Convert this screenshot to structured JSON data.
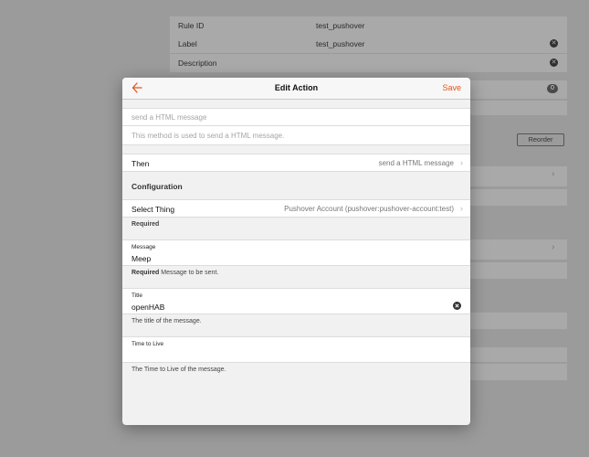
{
  "background": {
    "rule_id_label": "Rule ID",
    "rule_id_value": "test_pushover",
    "label_label": "Label",
    "label_value": "test_pushover",
    "description_label": "Description",
    "badge": "0",
    "reorder_label": "Reorder"
  },
  "modal": {
    "title": "Edit Action",
    "save_label": "Save",
    "summary_placeholder": "send a HTML message",
    "description_placeholder": "This method is used to send a HTML message.",
    "then_label": "Then",
    "then_value": "send a HTML message",
    "configuration_heading": "Configuration",
    "select_thing_label": "Select Thing",
    "select_thing_value": "Pushover Account (pushover:pushover-account:test)",
    "required_hint": "Required",
    "message": {
      "label": "Message",
      "value": "Meep",
      "hint_required": "Required",
      "hint_text": "Message to be sent."
    },
    "title_field": {
      "label": "Title",
      "value": "openHAB",
      "hint": "The title of the message."
    },
    "ttl_field": {
      "label": "Time to Live",
      "value": "",
      "hint": "The Time to Live of the message."
    }
  },
  "colors": {
    "accent": "#e8511b",
    "overlay": "#9b9b9b",
    "modal_bg": "#f1f1f1"
  },
  "icons": [
    "back-arrow-icon",
    "clear-icon",
    "chevron-right-icon"
  ]
}
